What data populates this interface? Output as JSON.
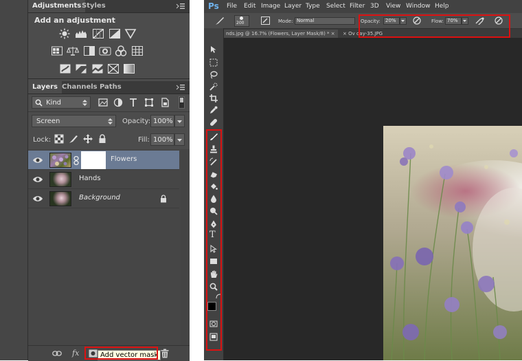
{
  "left": {
    "adjustments_panel": {
      "tabs": [
        "Adjustments",
        "Styles"
      ],
      "title": "Add an adjustment",
      "icons_row1": [
        "brightness-contrast-icon",
        "levels-icon",
        "curves-icon",
        "exposure-icon",
        "vibrance-icon"
      ],
      "icons_row2": [
        "hue-saturation-icon",
        "color-balance-icon",
        "black-white-icon",
        "photo-filter-icon",
        "channel-mixer-icon",
        "color-lookup-icon"
      ],
      "icons_row3": [
        "invert-icon",
        "posterize-icon",
        "threshold-icon",
        "selective-color-icon",
        "gradient-map-icon"
      ]
    },
    "layers_panel": {
      "tabs": [
        "Layers",
        "Channels",
        "Paths"
      ],
      "filter_kind": "Kind",
      "blend_mode": "Screen",
      "opacity_label": "Opacity:",
      "opacity_value": "100%",
      "lock_label": "Lock:",
      "fill_label": "Fill:",
      "fill_value": "100%",
      "layers": [
        {
          "name": "Flowers",
          "selected": true,
          "has_mask": true
        },
        {
          "name": "Hands",
          "selected": false,
          "has_mask": false
        },
        {
          "name": "Background",
          "selected": false,
          "locked": true,
          "italic": true
        }
      ],
      "bottom_icons": [
        "link-icon",
        "fx-icon",
        "add-vector-mask-icon",
        "delete-icon"
      ],
      "fx_label": "fx",
      "tooltip": "Add vector mask"
    }
  },
  "right": {
    "logo": "Ps",
    "menu": [
      "File",
      "Edit",
      "Image",
      "Layer",
      "Type",
      "Select",
      "Filter",
      "3D",
      "View",
      "Window",
      "Help"
    ],
    "options_bar": {
      "brush_size": "200",
      "mode_label": "Mode:",
      "mode_value": "Normal",
      "opacity_label": "Opacity:",
      "opacity_value": "20%",
      "flow_label": "Flow:",
      "flow_value": "70%"
    },
    "doc_tabs": [
      {
        "title": "nds.jpg @ 16.7% (Flowers, Layer Mask/8) *",
        "close": "×"
      },
      {
        "title": "Ov      day-35.JPG",
        "close": "×"
      }
    ],
    "tools": [
      "move-tool-icon",
      "marquee-tool-icon",
      "lasso-tool-icon",
      "quick-select-tool-icon",
      "crop-tool-icon",
      "eyedropper-tool-icon",
      "spot-heal-tool-icon",
      "brush-tool-icon",
      "clone-stamp-tool-icon",
      "history-brush-tool-icon",
      "eraser-tool-icon",
      "paint-bucket-tool-icon",
      "blur-tool-icon",
      "dodge-tool-icon",
      "pen-tool-icon",
      "type-tool-icon",
      "path-select-tool-icon",
      "rectangle-tool-icon",
      "hand-tool-icon",
      "zoom-tool-icon"
    ],
    "type_tool_glyph": "T",
    "colors": {
      "accent_red": "#d11111",
      "selection_blue": "#6b7b94",
      "ps_blue": "#6fb3ee"
    }
  }
}
